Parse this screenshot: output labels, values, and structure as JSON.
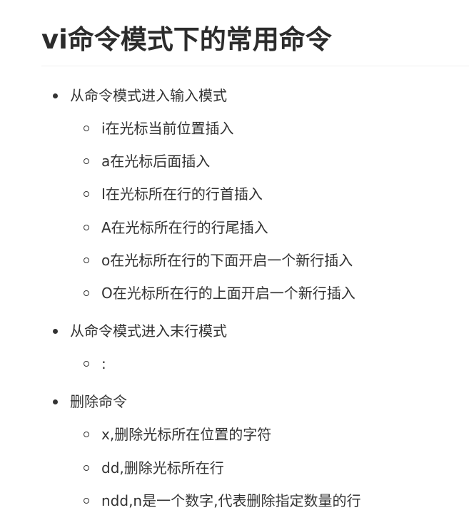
{
  "heading": "vi命令模式下的常用命令",
  "sections": [
    {
      "title": "从命令模式进入输入模式",
      "items": [
        "i在光标当前位置插入",
        "a在光标后面插入",
        "I在光标所在行的行首插入",
        "A在光标所在行的行尾插入",
        "o在光标所在行的下面开启一个新行插入",
        "O在光标所在行的上面开启一个新行插入"
      ]
    },
    {
      "title": "从命令模式进入末行模式",
      "items": [
        ":"
      ]
    },
    {
      "title": "删除命令",
      "items": [
        "x,删除光标所在位置的字符",
        "dd,删除光标所在行",
        "ndd,n是一个数字,代表删除指定数量的行"
      ]
    }
  ]
}
